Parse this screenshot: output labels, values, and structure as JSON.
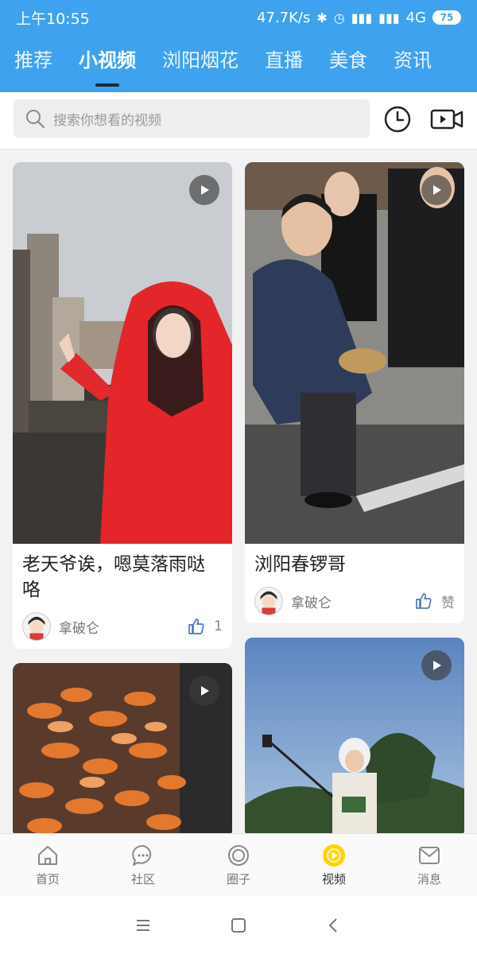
{
  "status_bar": {
    "time": "上午10:55",
    "speed": "47.7K/s",
    "network": "4G",
    "battery": "75"
  },
  "tabs": [
    {
      "label": "推荐",
      "active": false
    },
    {
      "label": "小视频",
      "active": true
    },
    {
      "label": "浏阳烟花",
      "active": false
    },
    {
      "label": "直播",
      "active": false
    },
    {
      "label": "美食",
      "active": false
    },
    {
      "label": "资讯",
      "active": false
    }
  ],
  "search": {
    "placeholder": "搜索你想看的视频"
  },
  "videos": [
    {
      "title": "老天爷诶，嗯莫落雨哒咯",
      "author": "拿破仑",
      "likes": "1"
    },
    {
      "title": "浏阳春锣哥",
      "author": "拿破仑",
      "likes": "赞"
    },
    {
      "title": "",
      "author": "",
      "likes": ""
    },
    {
      "title": "",
      "author": "",
      "likes": ""
    }
  ],
  "bottom_nav": [
    {
      "label": "首页",
      "icon": "home-icon"
    },
    {
      "label": "社区",
      "icon": "chat-icon"
    },
    {
      "label": "圈子",
      "icon": "circle-icon"
    },
    {
      "label": "视频",
      "icon": "video-play-icon"
    },
    {
      "label": "消息",
      "icon": "mail-icon"
    }
  ],
  "colors": {
    "header": "#3ea2ee",
    "accent_yellow": "#ffd400"
  }
}
